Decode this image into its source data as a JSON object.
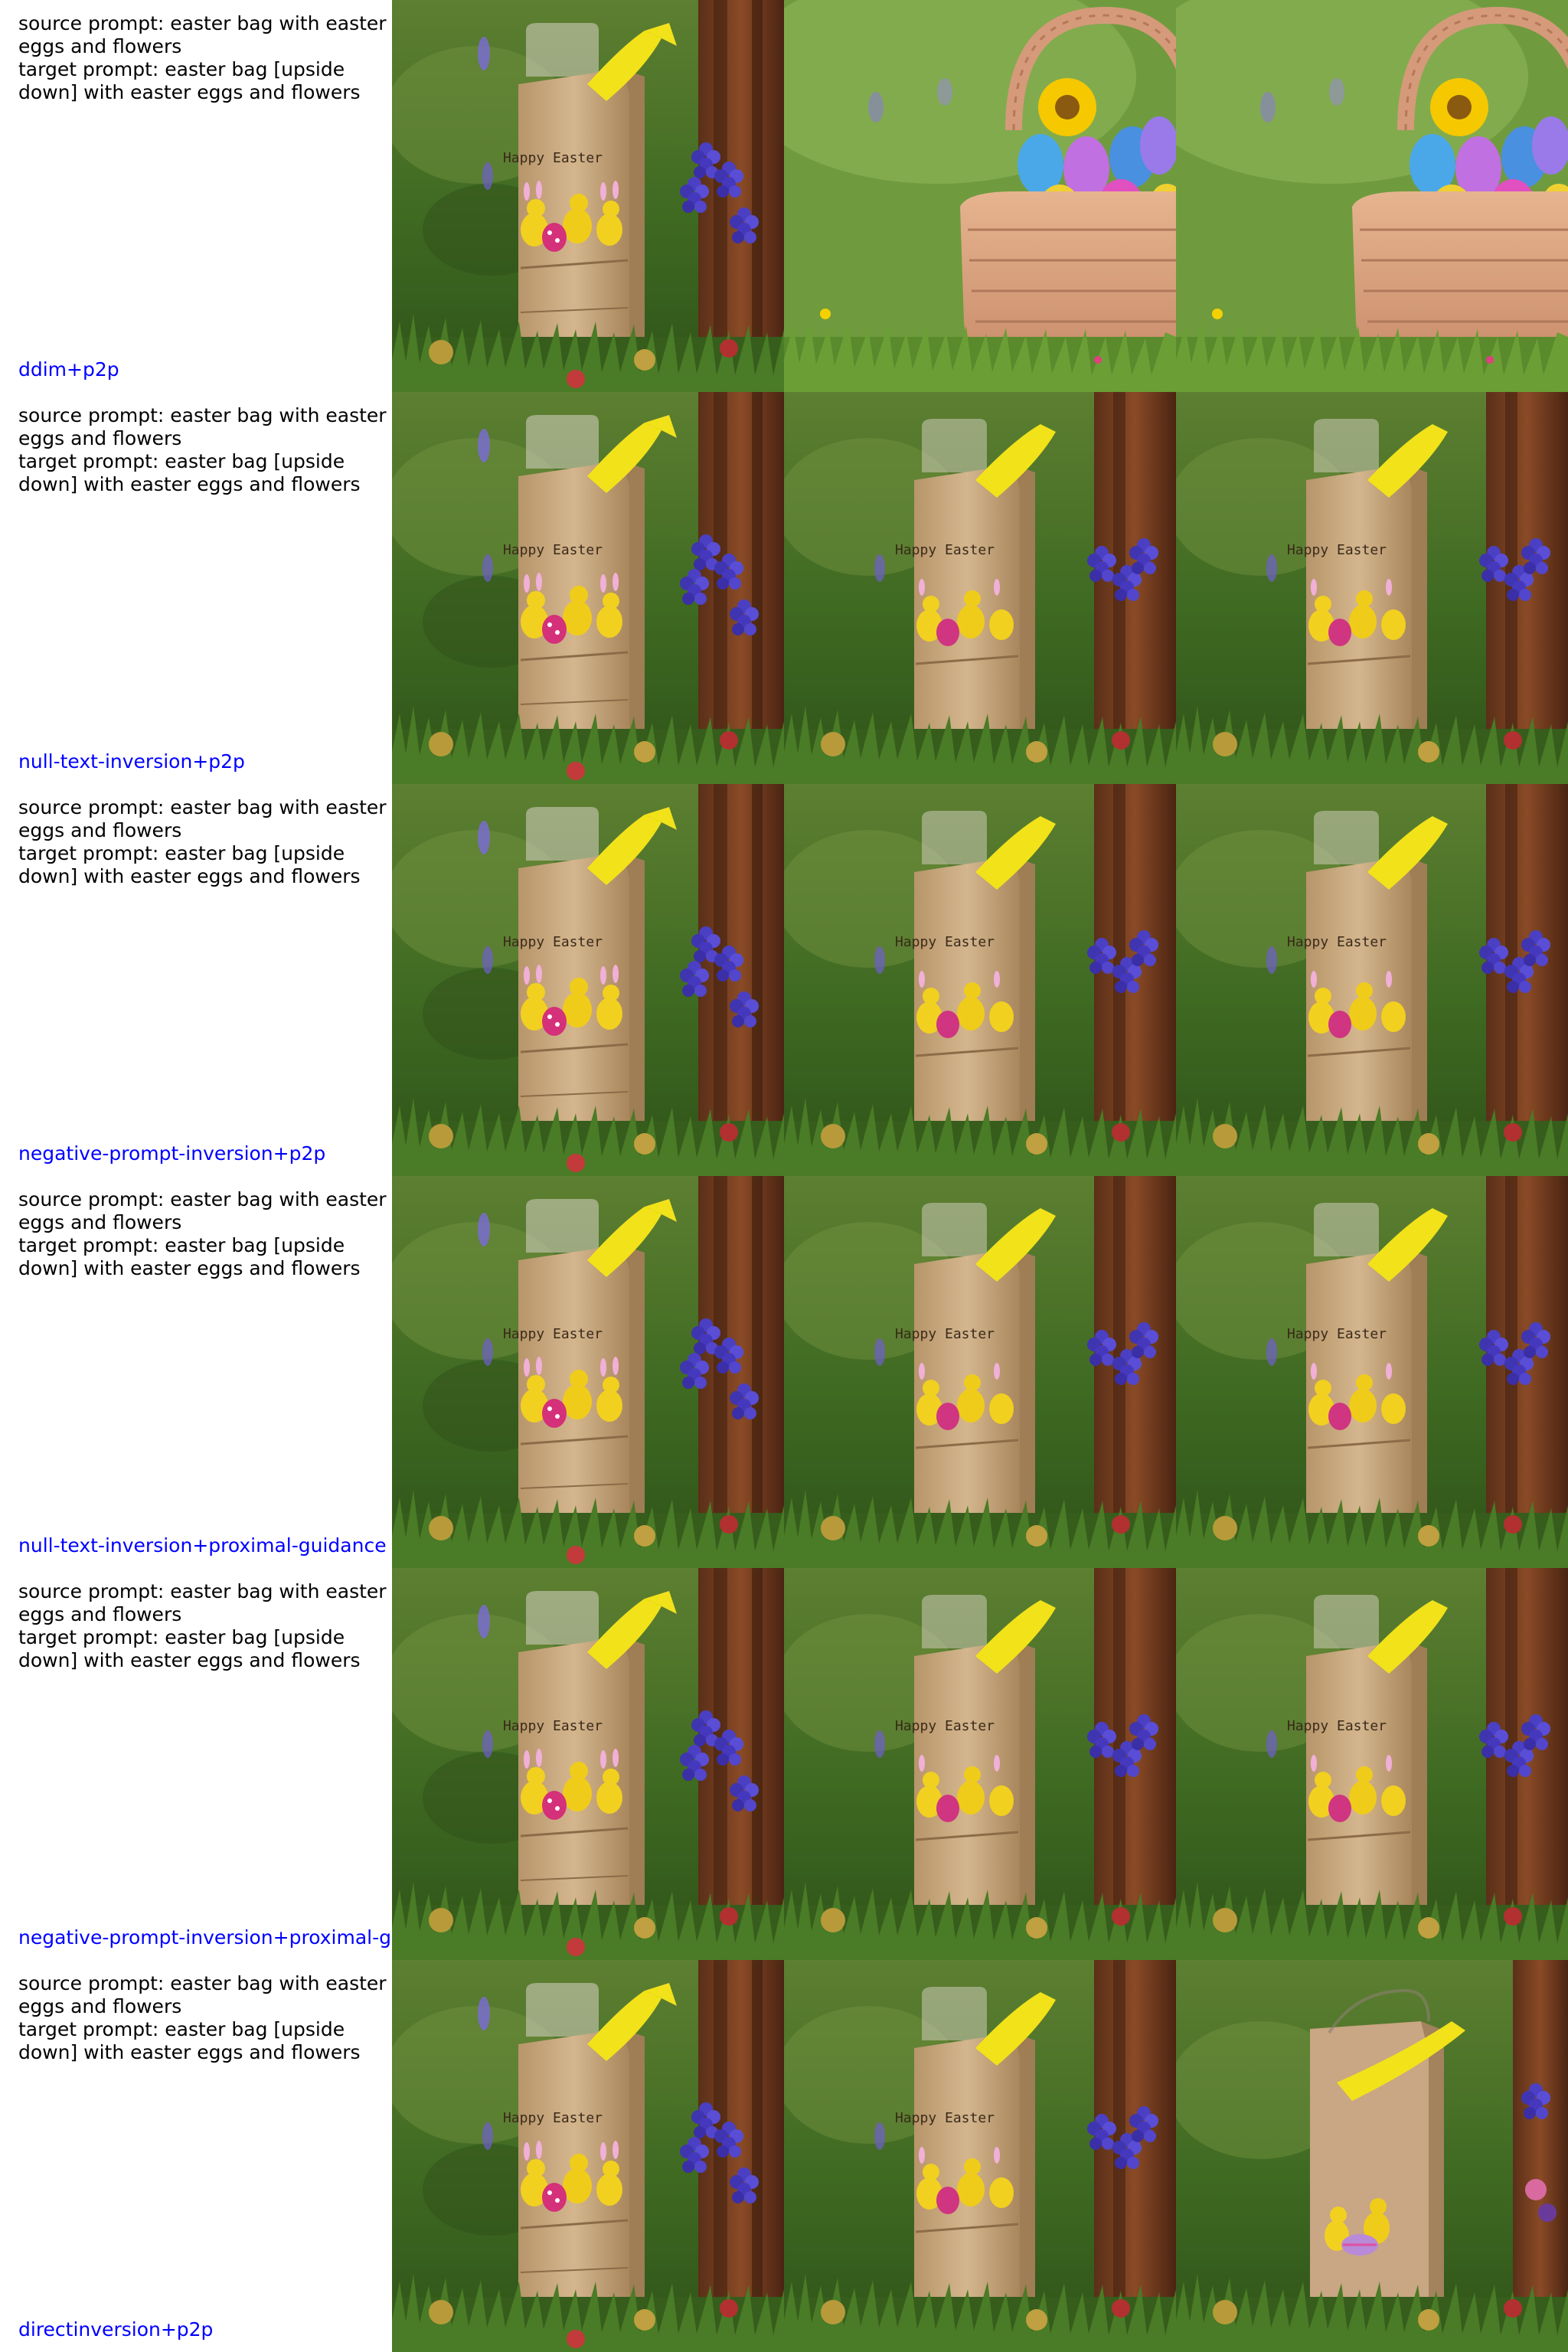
{
  "rows": [
    {
      "source_prompt": "source prompt: easter bag with easter eggs and flowers",
      "target_prompt": "target prompt: easter bag [upside down] with easter eggs and flowers",
      "method": "ddim+p2p",
      "bag_text": "Happy Easter",
      "images": [
        "bag-source-photo",
        "easter-basket-edit",
        "easter-basket-edit"
      ]
    },
    {
      "source_prompt": "source prompt: easter bag with easter eggs and flowers",
      "target_prompt": "target prompt: easter bag [upside down] with easter eggs and flowers",
      "method": "null-text-inversion+p2p",
      "bag_text": "Happy Easter",
      "images": [
        "bag-source-photo",
        "bag-edit",
        "bag-edit"
      ]
    },
    {
      "source_prompt": "source prompt: easter bag with easter eggs and flowers",
      "target_prompt": "target prompt: easter bag [upside down] with easter eggs and flowers",
      "method": "negative-prompt-inversion+p2p",
      "bag_text": "Happy Easter",
      "images": [
        "bag-source-photo",
        "bag-edit",
        "bag-edit"
      ]
    },
    {
      "source_prompt": "source prompt: easter bag with easter eggs and flowers",
      "target_prompt": "target prompt: easter bag [upside down] with easter eggs and flowers",
      "method": "null-text-inversion+proximal-guidance",
      "bag_text": "Happy Easter",
      "images": [
        "bag-source-photo",
        "bag-edit",
        "bag-edit"
      ]
    },
    {
      "source_prompt": "source prompt: easter bag with easter eggs and flowers",
      "target_prompt": "target prompt: easter bag [upside down] with easter eggs and flowers",
      "method": "negative-prompt-inversion+proximal-g",
      "bag_text": "Happy Easter",
      "images": [
        "bag-source-photo",
        "bag-edit",
        "bag-edit"
      ]
    },
    {
      "source_prompt": "source prompt: easter bag with easter eggs and flowers",
      "target_prompt": "target prompt: easter bag [upside down] with easter eggs and flowers",
      "method": "directinversion+p2p",
      "bag_text": "Happy Easter",
      "images": [
        "bag-source-photo",
        "bag-edit",
        "bag-edit-plain"
      ]
    }
  ],
  "colors": {
    "method_label": "#0000ff",
    "prompt_text": "#000000",
    "grass": "#4f7a2a",
    "bag": "#c9a87c",
    "handle": "#f2e21a",
    "hyacinth": "#4b3fc4"
  }
}
